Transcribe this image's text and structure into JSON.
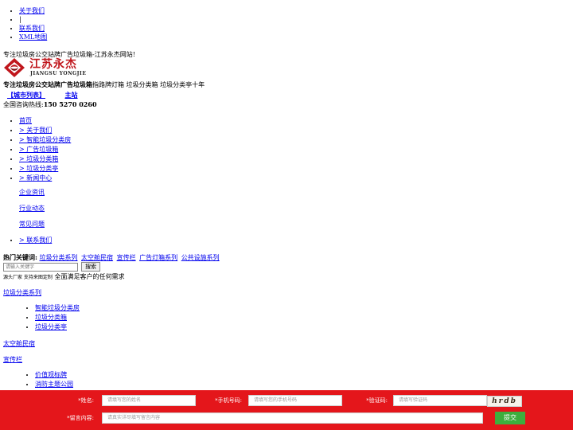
{
  "top_links": [
    "关于我们",
    "|",
    "联系我们",
    "XML地图"
  ],
  "tagline": "专注垃圾房公交站牌广告垃圾箱-江苏永杰网站!",
  "logo": {
    "cn": "江苏永杰",
    "en": "JIANGSU YONGJIE",
    "color": "#c0161c"
  },
  "slogan": {
    "bold": "专注垃圾房公交站牌广告垃圾箱",
    "rest": "指路牌灯箱 垃圾分类箱 垃圾分类亭十年"
  },
  "city_links": {
    "city_list": "【城市列表】",
    "main_site": "主站"
  },
  "hotline": {
    "label": "全国咨询热线:",
    "number": "150 5270 0260"
  },
  "nav": {
    "items": [
      "首页",
      "> 关于我们",
      "> 智能垃圾分类房",
      "> 广告垃圾箱",
      "> 垃圾分类箱",
      "> 垃圾分类亭",
      "> 新闻中心"
    ],
    "news_sub": [
      "企业资讯",
      "行业动态",
      "常见问题"
    ],
    "last": "> 联系我们"
  },
  "hot_keywords": {
    "label": "热门关键词:",
    "items": [
      "垃圾分类系列",
      "太空舱民宿",
      "宣传栏",
      "广告灯箱系列",
      "公共设施系列"
    ]
  },
  "search": {
    "placeholder": "请输入关键字",
    "button": "搜索"
  },
  "custom": {
    "small": "源头厂家 支持来图定制",
    "text": "全面满足客户的任何需求"
  },
  "categories": [
    {
      "title": "垃圾分类系列",
      "items": [
        "智能垃圾分类房",
        "垃圾分类箱",
        "垃圾分类亭"
      ]
    },
    {
      "title": "太空舱民宿",
      "items": []
    },
    {
      "title": "宣传栏",
      "items": [
        "价值观标牌",
        "消防主题公园"
      ]
    }
  ],
  "form": {
    "name_label": "*姓名:",
    "name_placeholder": "请填写您的姓名",
    "phone_label": "*手机号码:",
    "phone_placeholder": "请填写您的手机号码",
    "code_label": "*验证码:",
    "code_placeholder": "请填写验证码",
    "captcha": "hrdb",
    "msg_label": "*留言内容:",
    "msg_placeholder": "请真实详尽填写留言内容",
    "submit": "提交",
    "bar_color": "#e4161b",
    "submit_color": "#3dae3d"
  }
}
